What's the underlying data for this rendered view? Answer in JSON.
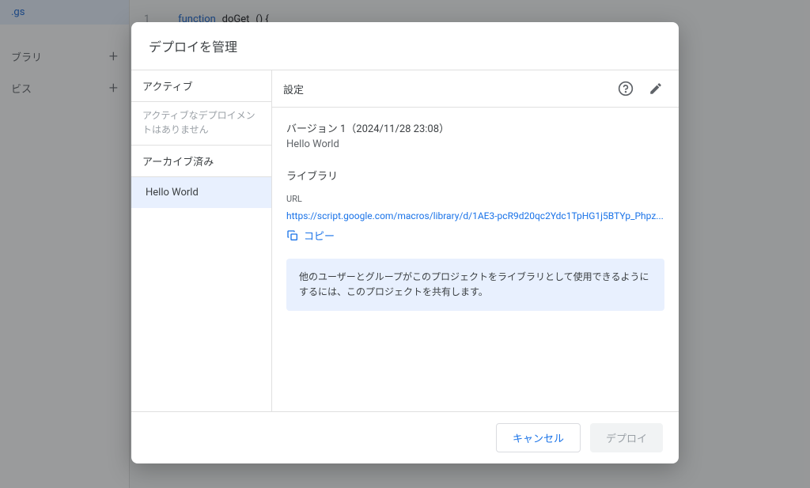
{
  "background": {
    "sidebar": {
      "file_item": ".gs",
      "library_label": "ブラリ",
      "services_label": "ビス"
    },
    "code": {
      "line_num": "1",
      "keyword": "function",
      "fn_name": "doGet",
      "parens": "() {"
    }
  },
  "dialog": {
    "title": "デプロイを管理",
    "left": {
      "active_label": "アクティブ",
      "active_empty": "アクティブなデプロイメントはありません",
      "archived_label": "アーカイブ済み",
      "deployment_name": "Hello World"
    },
    "right": {
      "header_label": "設定",
      "version_line": "バージョン 1（2024/11/28 23:08）",
      "description": "Hello World",
      "library_label": "ライブラリ",
      "url_label": "URL",
      "url_value": "https://script.google.com/macros/library/d/1AE3-pcR9d20qc2Ydc1TpHG1j5BTYp_Phpz...",
      "copy_label": "コピー",
      "info_text": "他のユーザーとグループがこのプロジェクトをライブラリとして使用できるようにするには、このプロジェクトを共有します。"
    },
    "footer": {
      "cancel": "キャンセル",
      "deploy": "デプロイ"
    }
  }
}
